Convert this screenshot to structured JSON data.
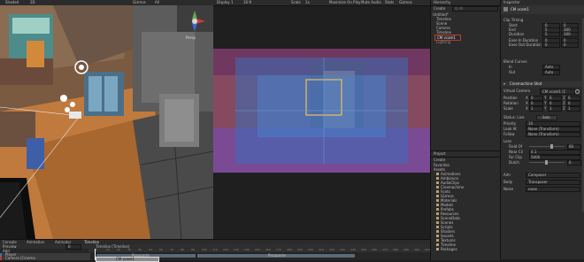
{
  "scene_view": {
    "toolbar_items": [
      "Shaded",
      "2D",
      "Gizmos",
      "All"
    ],
    "orientation_label": "Persp"
  },
  "game_view": {
    "toolbar_items": [
      "Display 1",
      "16:9",
      "Scale",
      "1x",
      "Maximize On Play",
      "Mute Audio",
      "Stats",
      "Gizmos"
    ]
  },
  "hierarchy": {
    "tab": "Hierarchy",
    "create": "Create",
    "search_placeholder": "Q All",
    "items": [
      "Untitled*",
      "Timeline",
      "Scene",
      "Camera",
      "Timeline",
      "CM vcam1",
      "Lighting"
    ],
    "selected": "CM vcam1"
  },
  "project": {
    "tab": "Project",
    "create": "Create",
    "favorites_label": "Favorites",
    "assets_label": "Assets",
    "folders": [
      "Animations",
      "Ambiance",
      "AudioClips",
      "Cinemachine",
      "Fonts",
      "Gizmos",
      "Materials",
      "Models",
      "Prefabs",
      "Resources",
      "SceneData",
      "Scenes",
      "Scripts",
      "Shaders",
      "Sounds",
      "Textures",
      "Timeline",
      "Packages"
    ]
  },
  "inspector": {
    "tab": "Inspector",
    "object_name": "CM vcam1",
    "clip_timing_label": "Clip Timing",
    "timing_rows": [
      {
        "label": "Start",
        "s": "0",
        "f": "0"
      },
      {
        "label": "End",
        "s": "5",
        "f": "300"
      },
      {
        "label": "Duration",
        "s": "5",
        "f": "300"
      },
      {
        "label": "Ease In Duration",
        "s": "0",
        "f": "0"
      },
      {
        "label": "Ease Out Duration",
        "s": "0",
        "f": "0"
      }
    ],
    "blend_curves_label": "Blend Curves",
    "blend_rows": [
      {
        "label": "In",
        "value": "Auto"
      },
      {
        "label": "Out",
        "value": "Auto"
      }
    ],
    "shot_header": "Cinemachine Shot",
    "virtual_camera_label": "Virtual Camera",
    "virtual_camera_value": "CM vcam1 (C",
    "transform_rows": [
      {
        "label": "Position",
        "x": "0",
        "y": "0",
        "z": "0"
      },
      {
        "label": "Rotation",
        "x": "0",
        "y": "0",
        "z": "0"
      },
      {
        "label": "Scale",
        "x": "1",
        "y": "1",
        "z": "1"
      }
    ],
    "status_label": "Status: Live",
    "solo_label": "Solo",
    "priority_label": "Priority",
    "priority_value": "10",
    "lookat_label": "Look At",
    "lookat_value": "None (Transform)",
    "follow_label": "Follow",
    "follow_value": "None (Transform)",
    "lens_label": "Lens",
    "lens_rows": [
      {
        "label": "Field Of",
        "value": "60"
      },
      {
        "label": "Near Cli",
        "value": "0.1"
      },
      {
        "label": "Far Clip",
        "value": "5000"
      },
      {
        "label": "Dutch",
        "value": "0"
      }
    ],
    "aim_label": "Aim",
    "aim_value": "Composer",
    "body_label": "Body",
    "body_value": "Transposer",
    "noise_label": "Noise",
    "noise_value": "none"
  },
  "timeline": {
    "tabs": [
      "Console",
      "Animation",
      "Animator",
      "Timeline"
    ],
    "preview_label": "Preview",
    "frame_value": "0",
    "asset_title": "Timeline (Timeline)",
    "ruler_ticks": [
      "0",
      "10",
      "20",
      "30",
      "40",
      "50",
      "60",
      "70",
      "80",
      "90",
      "100",
      "110",
      "120",
      "130",
      "140",
      "150",
      "160",
      "170",
      "180",
      "190",
      "200",
      "210",
      "220",
      "230",
      "240",
      "250",
      "260",
      "270",
      "280",
      "290",
      "300",
      "310"
    ],
    "add_label": "Add",
    "tracks": [
      {
        "name": "Player",
        "clips": [
          "Pasaporte",
          "Pasaporte"
        ]
      },
      {
        "name": "Camera (Cinema",
        "clips": [
          "CM vcam1"
        ]
      }
    ]
  },
  "colors": {
    "panel_bg": "#2b2b2b",
    "selection": "#3d6ea0",
    "accent_red": "#c0392b",
    "overlay_blue": "#3a6db8",
    "overlay_purple": "#7a4aa8"
  }
}
